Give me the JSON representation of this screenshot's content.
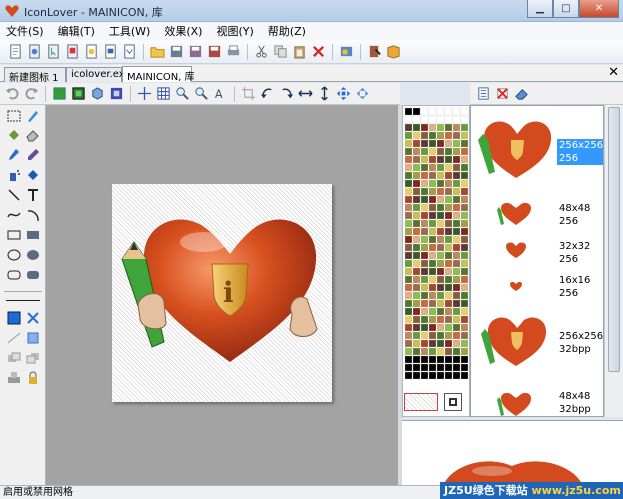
{
  "window": {
    "title": "IconLover - MAINICON, 库"
  },
  "menu": [
    "文件(S)",
    "编辑(T)",
    "工具(W)",
    "效果(X)",
    "视图(Y)",
    "帮助(Z)"
  ],
  "tabs": [
    "新建图标 1",
    "icolover.exe",
    "MAINICON, 库"
  ],
  "formats": [
    {
      "size": "256x256",
      "depth": "256"
    },
    {
      "size": "48x48",
      "depth": "256"
    },
    {
      "size": "32x32",
      "depth": "256"
    },
    {
      "size": "16x16",
      "depth": "256"
    },
    {
      "size": "256x256",
      "depth": "32bpp"
    },
    {
      "size": "48x48",
      "depth": "32bpp"
    }
  ],
  "status": {
    "text": "启用或禁用网格"
  },
  "watermark": {
    "brand": "JZ5U绿色下载站",
    "url": "www.jz5u.com"
  },
  "colors": {
    "accent": "#3399ff",
    "heart": "#c8401c",
    "canvas": "#a3a3a3"
  }
}
